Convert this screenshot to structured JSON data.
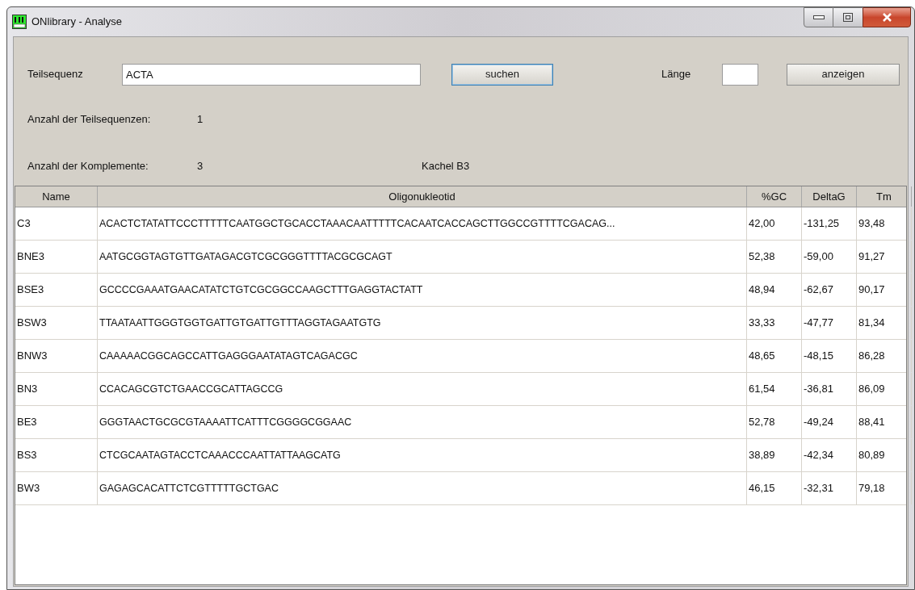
{
  "window": {
    "title": "ONlibrary - Analyse"
  },
  "search": {
    "label": "Teilsequenz",
    "value": "ACTA"
  },
  "search_button": {
    "label": "suchen",
    "focused": true
  },
  "length": {
    "label": "Länge"
  },
  "show_button": {
    "label": "anzeigen",
    "focused": false
  },
  "stats": [
    {
      "label": "Anzahl der Teilsequenzen:",
      "value": "1"
    },
    {
      "label": "Anzahl der Komplemente:",
      "value": "3",
      "note": "Kachel B3"
    }
  ],
  "table": {
    "columns": [
      "Name",
      "Oligonukleotid",
      "%GC",
      "DeltaG",
      "Tm"
    ],
    "rows": [
      [
        "C3",
        "ACACTCTATATTCCCTTTTTCAATGGCTGCACCTAAACAATTTTTCACAATCACCAGCTTGGCCGTTTTCGACAG...",
        "42,00",
        "-131,25",
        "93,48"
      ],
      [
        "BNE3",
        "AATGCGGTAGTGTTGATAGACGTCGCGGGTTTTACGCGCAGT",
        "52,38",
        "-59,00",
        "91,27"
      ],
      [
        "BSE3",
        "GCCCCGAAATGAACATATCTGTCGCGGCCAAGCTTTGAGGTACTATT",
        "48,94",
        "-62,67",
        "90,17"
      ],
      [
        "BSW3",
        "TTAATAATTGGGTGGTGATTGTGATTGTTTAGGTAGAATGTG",
        "33,33",
        "-47,77",
        "81,34"
      ],
      [
        "BNW3",
        "CAAAAACGGCAGCCATTGAGGGAATATAGTCAGACGC",
        "48,65",
        "-48,15",
        "86,28"
      ],
      [
        "BN3",
        "CCACAGCGTCTGAACCGCATTAGCCG",
        "61,54",
        "-36,81",
        "86,09"
      ],
      [
        "BE3",
        "GGGTAACTGCGCGTAAAATTCATTTCGGGGCGGAAC",
        "52,78",
        "-49,24",
        "88,41"
      ],
      [
        "BS3",
        "CTCGCAATAGTACCTCAAACCCAATTATTAAGCATG",
        "38,89",
        "-42,34",
        "80,89"
      ],
      [
        "BW3",
        "GAGAGCACATTCTCGTTTTTGCTGAC",
        "46,15",
        "-32,31",
        "79,18"
      ]
    ]
  }
}
